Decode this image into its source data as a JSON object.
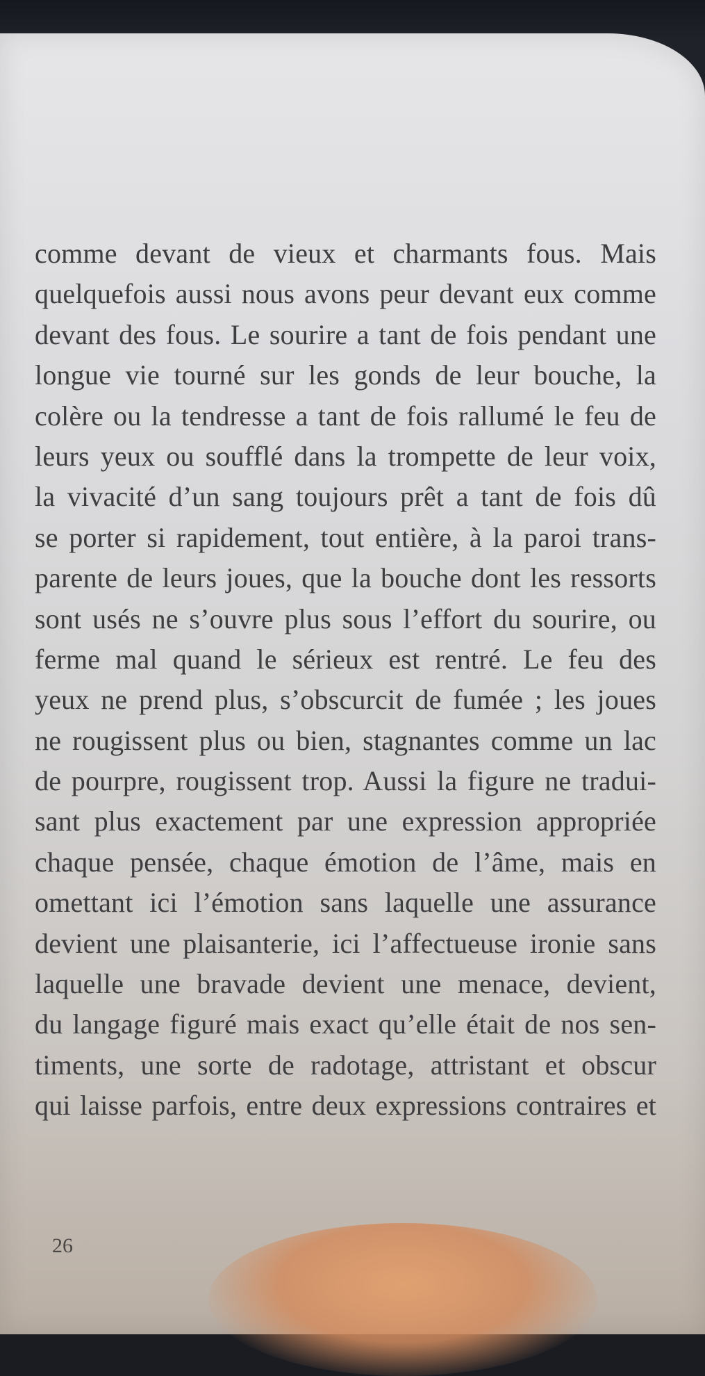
{
  "document": {
    "lines": [
      "comme devant de vieux et charmants fous. Mais",
      "quelquefois aussi nous avons peur devant eux comme",
      "devant des fous. Le sourire a tant de fois pendant une",
      "longue vie tourné sur les gonds de leur bouche, la",
      "colère ou la tendresse a tant de fois rallumé le feu de",
      "leurs yeux ou soufflé dans la trompette de leur voix,",
      "la vivacité d’un sang toujours prêt a tant de fois dû",
      "se porter si rapidement, tout entière, à la paroi trans-",
      "parente de leurs joues, que la bouche dont les ressorts",
      "sont usés ne s’ouvre plus sous l’effort du sourire, ou",
      "ferme mal quand le sérieux est rentré. Le feu des",
      "yeux ne prend plus, s’obscurcit de fumée ; les joues",
      "ne rougissent plus ou bien, stagnantes comme un lac",
      "de pourpre, rougissent trop. Aussi la figure ne tradui-",
      "sant plus exactement par une expression appropriée",
      "chaque pensée, chaque émotion de l’âme, mais en",
      "omettant ici l’émotion sans laquelle une assurance",
      "devient une plaisanterie, ici l’affectueuse ironie sans",
      "laquelle une bravade devient une menace, devient,",
      "du langage figuré mais exact qu’elle était de nos sen-",
      "timents, une sorte de radotage, attristant et obscur",
      "qui laisse parfois, entre deux expressions contraires et"
    ],
    "page_number": "26"
  }
}
